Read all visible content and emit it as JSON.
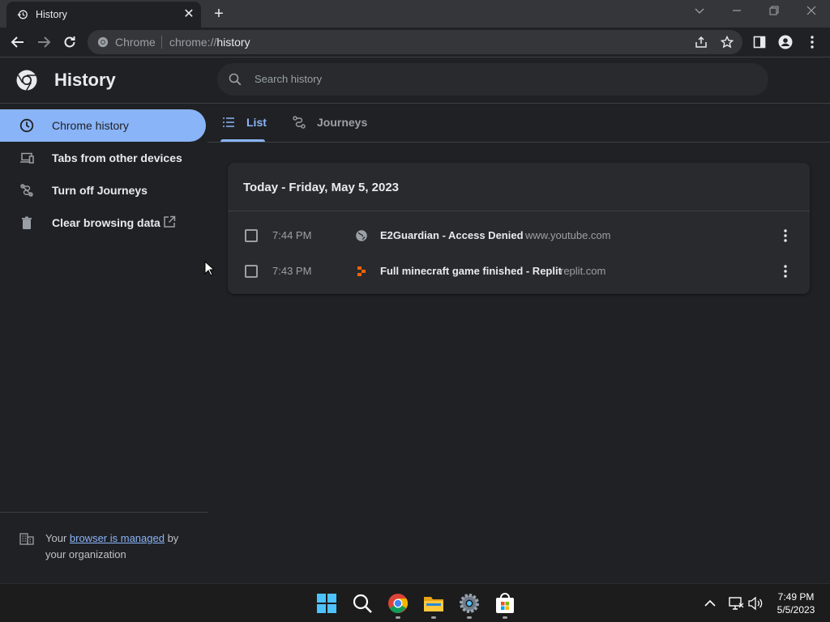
{
  "window": {
    "tab_title": "History",
    "tab_close": "✕",
    "new_tab": "+"
  },
  "toolbar": {
    "omnibox_chip": "Chrome",
    "url_scheme": "chrome://",
    "url_path": "history"
  },
  "header": {
    "title": "History",
    "search_placeholder": "Search history"
  },
  "sidebar": {
    "items": [
      {
        "label": "Chrome history",
        "icon": "clock-icon",
        "active": true
      },
      {
        "label": "Tabs from other devices",
        "icon": "devices-icon",
        "active": false
      },
      {
        "label": "Turn off Journeys",
        "icon": "journeys-off-icon",
        "active": false
      },
      {
        "label": "Clear browsing data",
        "icon": "trash-icon",
        "active": false
      }
    ],
    "managed": {
      "prefix": "Your ",
      "link": "browser is managed",
      "suffix": " by your organization"
    }
  },
  "main": {
    "tabs": [
      {
        "label": "List",
        "icon": "list-icon",
        "selected": true
      },
      {
        "label": "Journeys",
        "icon": "journeys-icon",
        "selected": false
      }
    ],
    "card": {
      "title": "Today - Friday, May 5, 2023",
      "entries": [
        {
          "time": "7:44 PM",
          "title": "E2Guardian - Access Denied",
          "domain": "www.youtube.com",
          "favicon": "globe-icon"
        },
        {
          "time": "7:43 PM",
          "title": "Full minecraft game finished - Replit",
          "domain": "replit.com",
          "favicon": "replit-icon"
        }
      ]
    }
  },
  "taskbar": {
    "time": "7:49 PM",
    "date": "5/5/2023",
    "apps": [
      "windows-start-icon",
      "search-icon",
      "chrome-icon",
      "file-explorer-icon",
      "settings-icon",
      "store-icon"
    ]
  },
  "colors": {
    "accent": "#8ab4f8",
    "background": "#202124",
    "card": "#292a2d"
  }
}
